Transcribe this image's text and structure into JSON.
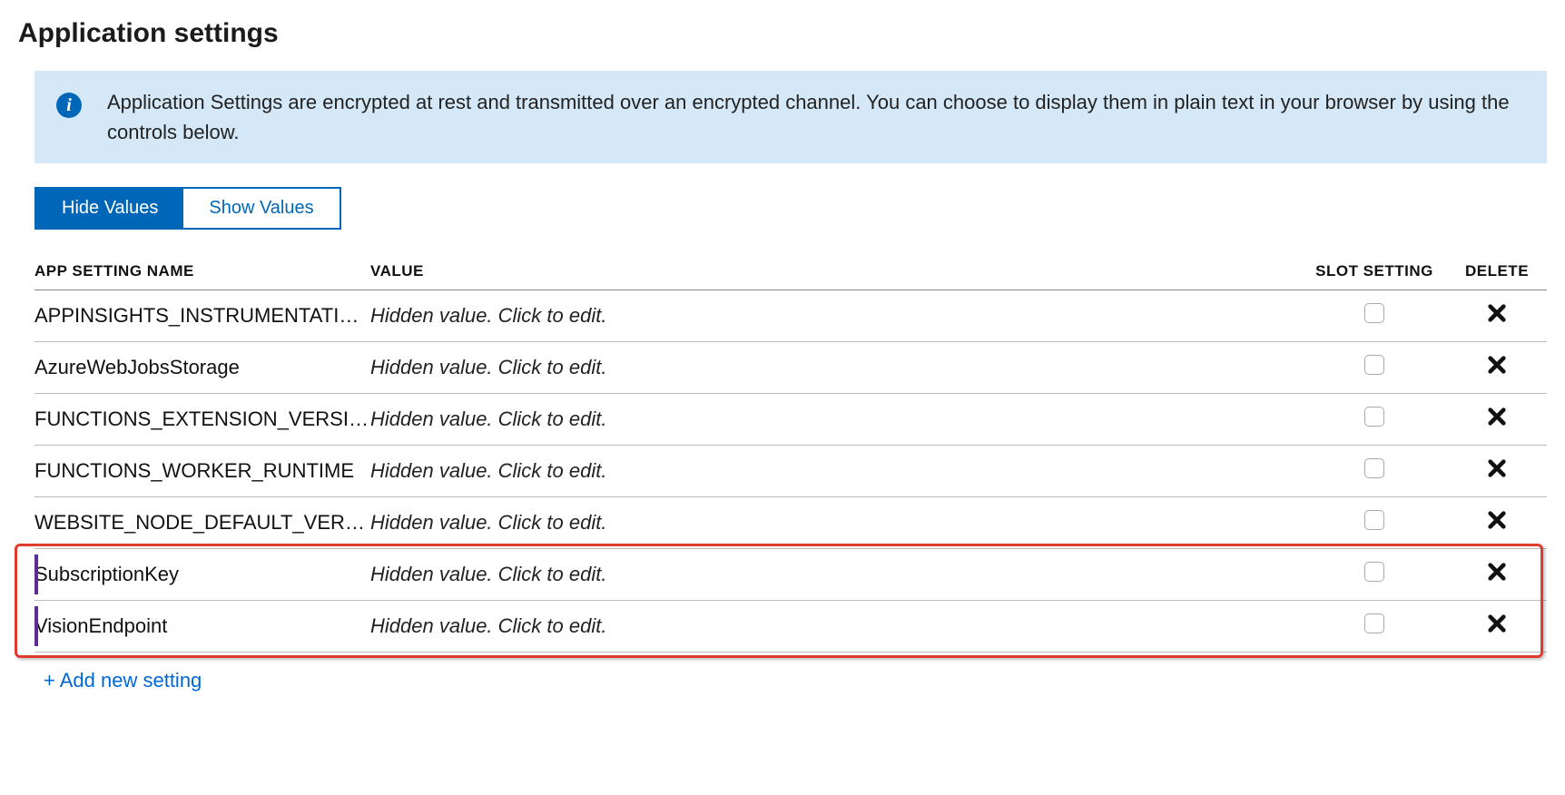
{
  "title": "Application settings",
  "info": {
    "icon_glyph": "i",
    "text": "Application Settings are encrypted at rest and transmitted over an encrypted channel. You can choose to display them in plain text in your browser by using the controls below."
  },
  "toggle": {
    "hide_label": "Hide Values",
    "show_label": "Show Values"
  },
  "table": {
    "headers": {
      "name": "App Setting Name",
      "value": "Value",
      "slot": "Slot Setting",
      "delete": "Delete"
    },
    "hidden_value_text": "Hidden value. Click to edit.",
    "rows": [
      {
        "name": "APPINSIGHTS_INSTRUMENTATI…",
        "highlighted": false
      },
      {
        "name": "AzureWebJobsStorage",
        "highlighted": false
      },
      {
        "name": "FUNCTIONS_EXTENSION_VERSI…",
        "highlighted": false
      },
      {
        "name": "FUNCTIONS_WORKER_RUNTIME",
        "highlighted": false
      },
      {
        "name": "WEBSITE_NODE_DEFAULT_VER…",
        "highlighted": false
      },
      {
        "name": "SubscriptionKey",
        "highlighted": true
      },
      {
        "name": "VisionEndpoint",
        "highlighted": true
      }
    ]
  },
  "add_link_label": "+ Add new setting"
}
